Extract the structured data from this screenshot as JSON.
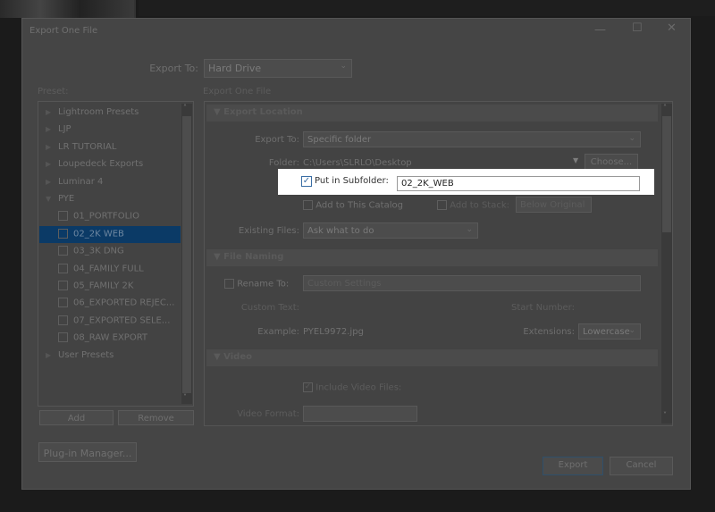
{
  "window": {
    "title": "Export One File",
    "controls": [
      "minimize-icon",
      "maximize-icon",
      "close-icon"
    ]
  },
  "export_to": {
    "label": "Export To:",
    "value": "Hard Drive"
  },
  "preset": {
    "label": "Preset:",
    "items": [
      {
        "label": "Lightroom Presets",
        "type": "folder",
        "expanded": false
      },
      {
        "label": "LJP",
        "type": "folder",
        "expanded": false
      },
      {
        "label": "LR TUTORIAL",
        "type": "folder",
        "expanded": false
      },
      {
        "label": "Loupedeck Exports",
        "type": "folder",
        "expanded": false
      },
      {
        "label": "Luminar 4",
        "type": "folder",
        "expanded": false
      },
      {
        "label": "PYE",
        "type": "folder",
        "expanded": true
      },
      {
        "label": "01_PORTFOLIO",
        "type": "preset"
      },
      {
        "label": "02_2K WEB",
        "type": "preset",
        "selected": true
      },
      {
        "label": "03_3K DNG",
        "type": "preset"
      },
      {
        "label": "04_FAMILY FULL",
        "type": "preset"
      },
      {
        "label": "05_FAMILY 2K",
        "type": "preset"
      },
      {
        "label": "06_EXPORTED REJEC...",
        "type": "preset"
      },
      {
        "label": "07_EXPORTED SELE...",
        "type": "preset"
      },
      {
        "label": "08_RAW EXPORT",
        "type": "preset"
      },
      {
        "label": "User Presets",
        "type": "folder",
        "expanded": false
      }
    ],
    "add": "Add",
    "remove": "Remove"
  },
  "plugin_manager": "Plug-in Manager...",
  "settings": {
    "label": "Export One File",
    "export_location": {
      "header": "Export Location",
      "export_to_label": "Export To:",
      "export_to_value": "Specific folder",
      "folder_label": "Folder:",
      "folder_value": "C:\\Users\\SLRLO\\Desktop",
      "choose": "Choose...",
      "subfolder_label": "Put in Subfolder:",
      "subfolder_checked": true,
      "subfolder_value": "02_2K_WEB",
      "add_catalog": "Add to This Catalog",
      "add_stack": "Add to Stack:",
      "stack_value": "Below Original",
      "existing_label": "Existing Files:",
      "existing_value": "Ask what to do"
    },
    "file_naming": {
      "header": "File Naming",
      "rename_label": "Rename To:",
      "rename_value": "Custom Settings",
      "custom_text": "Custom Text:",
      "start_number": "Start Number:",
      "example_label": "Example:",
      "example_value": "PYEL9972.jpg",
      "extensions_label": "Extensions:",
      "extensions_value": "Lowercase"
    },
    "video": {
      "header": "Video",
      "include": "Include Video Files:",
      "format_label": "Video Format:"
    }
  },
  "buttons": {
    "export": "Export",
    "cancel": "Cancel"
  },
  "colors": {
    "selection": "#0b3a66",
    "highlight": "#ffffff",
    "dim_overlay": "#454545"
  }
}
